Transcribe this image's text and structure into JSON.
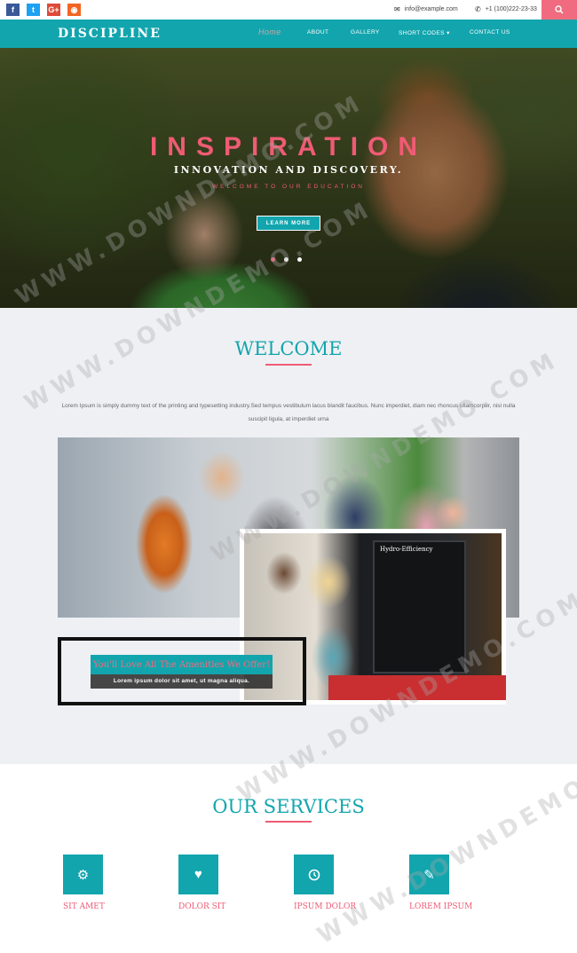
{
  "topbar": {
    "social": [
      {
        "icon": "facebook-icon",
        "glyph": "f"
      },
      {
        "icon": "twitter-icon",
        "glyph": "t"
      },
      {
        "icon": "google-plus-icon",
        "glyph": "G+"
      },
      {
        "icon": "rss-icon",
        "glyph": "◉"
      }
    ],
    "email": "info@example.com",
    "phone": "+1 (100)222-23-33"
  },
  "nav": {
    "logo": "DISCIPLINE",
    "items": [
      "Home",
      "ABOUT",
      "GALLERY",
      "SHORT CODES",
      "CONTACT US"
    ]
  },
  "hero": {
    "title": "INSPIRATION",
    "subtitle": "INNOVATION AND DISCOVERY.",
    "small": "WELCOME TO OUR EDUCATION",
    "button": "LEARN MORE"
  },
  "welcome": {
    "title": "WELCOME",
    "text": "Lorem Ipsum is simply dummy text of the printing and typesetting industry.Sed tempus vestibulum lacus blandit faucibus. Nunc imperdiet, diam nec rhoncus ullamcorper, nisl nulla suscipit ligula, at imperdiet urna",
    "poster_title": "Hydro-Efficiency",
    "banner_title": "You'll Love All The Amenities We Offer!",
    "banner_sub": "Lorem ipsum dolor sit amet, ut magna aliqua."
  },
  "services": {
    "title": "OUR SERVICES",
    "items": [
      {
        "label": "SIT AMET",
        "icon": "gear-icon"
      },
      {
        "label": "DOLOR SIT",
        "icon": "heart-icon"
      },
      {
        "label": "IPSUM DOLOR",
        "icon": "clock-icon"
      },
      {
        "label": "LOREM IPSUM",
        "icon": "pencil-icon"
      }
    ]
  },
  "watermark": "WWW.DOWNDEMO.COM",
  "colors": {
    "accent": "#12a5ad",
    "pink": "#ef5b74"
  }
}
